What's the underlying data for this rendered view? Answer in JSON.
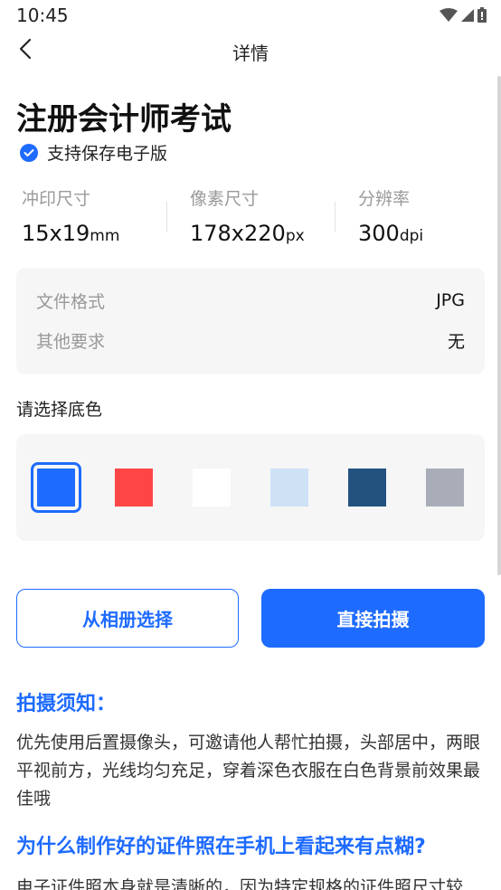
{
  "status_bar": {
    "time": "10:45"
  },
  "nav": {
    "title": "详情"
  },
  "page": {
    "title": "注册会计师考试",
    "ebook_label": "支持保存电子版"
  },
  "specs": [
    {
      "label": "冲印尺寸",
      "value": "15x19",
      "unit": "mm"
    },
    {
      "label": "像素尺寸",
      "value": "178x220",
      "unit": "px"
    },
    {
      "label": "分辨率",
      "value": "300",
      "unit": "dpi"
    }
  ],
  "info": {
    "format_label": "文件格式",
    "format_value": "JPG",
    "other_label": "其他要求",
    "other_value": "无"
  },
  "background": {
    "title": "请选择底色",
    "selected_index": 0,
    "colors": [
      "#1e6bff",
      "#ff4646",
      "#ffffff",
      "#cfe1f5",
      "#23527f",
      "#a9adb7"
    ]
  },
  "buttons": {
    "album": "从相册选择",
    "shoot": "直接拍摄"
  },
  "tips": {
    "title": "拍摄须知：",
    "text": "优先使用后置摄像头，可邀请他人帮忙拍摄，头部居中，两眼平视前方，光线均匀充足，穿着深色衣服在白色背景前效果最佳哦"
  },
  "faq": {
    "title": "为什么制作好的证件照在手机上看起来有点糊?",
    "text": "电子证件照本身就是清晰的，因为特定规格的证件照尺寸较"
  },
  "colors": {
    "accent": "#1e6bff"
  }
}
